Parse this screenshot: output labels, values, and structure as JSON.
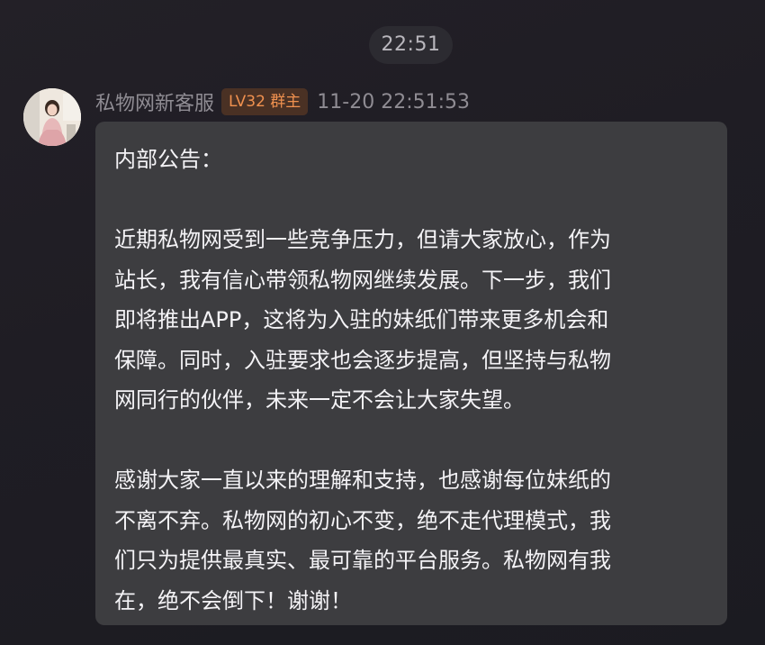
{
  "time_divider": "22:51",
  "message": {
    "sender_name": "私物网新客服",
    "level_badge": "LV32 群主",
    "timestamp": "11-20 22:51:53",
    "avatar_icon": "user-avatar-photo",
    "lines": {
      "heading": "内部公告：",
      "p1_l1": "近期私物网受到一些竞争压力，但请大家放心，作为",
      "p1_l2": "站长，我有信心带领私物网继续发展。下一步，我们",
      "p1_l3": "即将推出APP，这将为入驻的妹纸们带来更多机会和",
      "p1_l4": "保障。同时，入驻要求也会逐步提高，但坚持与私物",
      "p1_l5": "网同行的伙伴，未来一定不会让大家失望。",
      "p2_l1": "感谢大家一直以来的理解和支持，也感谢每位妹纸的",
      "p2_l2": "不离不弃。私物网的初心不变，绝不走代理模式，我",
      "p2_l3": "们只为提供最真实、最可靠的平台服务。私物网有我",
      "p2_l4": "在，绝不会倒下！谢谢！"
    }
  },
  "colors": {
    "background": "#1f1d24",
    "bubble": "#3d3d40",
    "badge_background": "#4a3124",
    "badge_text": "#f0914f",
    "meta_text": "#8f8c93"
  }
}
